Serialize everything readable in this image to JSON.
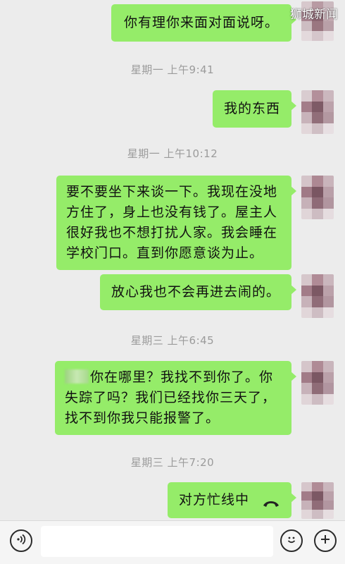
{
  "watermark": "狮城新闻",
  "messages": [
    {
      "kind": "bubble",
      "text": "你有理你来面对面说呀。"
    },
    {
      "kind": "time",
      "text": "星期一 上午9:41"
    },
    {
      "kind": "bubble",
      "text": "我的东西"
    },
    {
      "kind": "time",
      "text": "星期一 上午10:12"
    },
    {
      "kind": "bubble",
      "lines": [
        "要不要坐下来谈一下。我现在没地",
        "方住了，身上也没有钱了。屋主人",
        "很好我也不想打扰人家。我会睡在",
        "学校门口。直到你愿意谈为止。"
      ]
    },
    {
      "kind": "bubble",
      "text": "放心我也不会再进去闹的。"
    },
    {
      "kind": "time",
      "text": "星期三 上午6:45"
    },
    {
      "kind": "bubble",
      "lines": [
        "你在哪里？我找不到你了。你",
        "失踪了吗？我们已经找你三天了，",
        "找不到你我只能报警了。"
      ]
    },
    {
      "kind": "time",
      "text": "星期三 上午7:20"
    },
    {
      "kind": "bubble",
      "text": "对方忙线中"
    }
  ],
  "input": {
    "value": "",
    "placeholder": ""
  },
  "icons": {
    "voice": "voice-icon",
    "emoji": "emoji-icon",
    "add": "plus-icon",
    "hangup": "phone-hangup-icon",
    "avatar": "pixelated-avatar"
  },
  "colors": {
    "background": "#ececec",
    "bubble": "#95ec69",
    "timestamp": "#9b9b9b",
    "bottombar": "#f5f5f5"
  }
}
